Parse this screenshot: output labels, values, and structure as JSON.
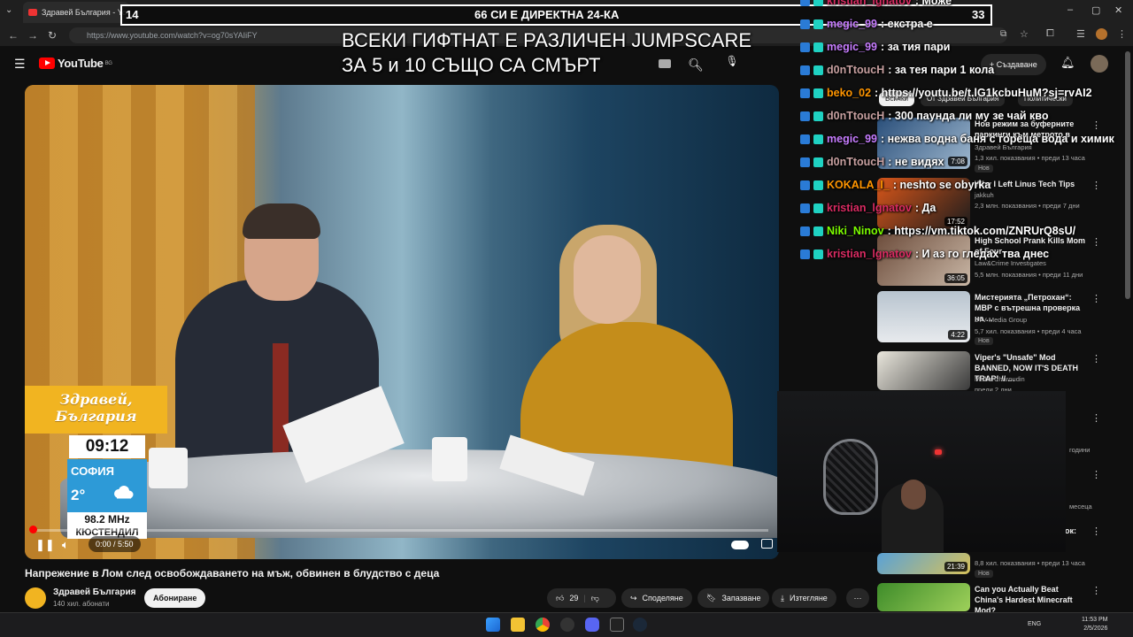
{
  "browser": {
    "tab_title": "Здравей България - YouTube",
    "url": "https://www.youtube.com/watch?v=og70sYAIiFY"
  },
  "youtube": {
    "logo_text": "YouTube",
    "logo_country": "BG",
    "create_label": "+ Създаване"
  },
  "overlay": {
    "left_count": "14",
    "center_text": "66 СИ Е ДИРЕКТНА 24-КА",
    "right_count": "33",
    "banner_line1": "ВСЕКИ ГИФТНАТ Е РАЗЛИЧЕН JUMPSCARE",
    "banner_line2": "ЗА 5 и 10 СЪЩО СА СМЪРТ"
  },
  "chat": [
    {
      "user": "kristian_lgnatov",
      "msg": ": Може",
      "color": "#d92b62"
    },
    {
      "user": "megic_99",
      "msg": ": екстра е",
      "color": "#c77dff"
    },
    {
      "user": "megic_99",
      "msg": ": за тия пари",
      "color": "#c77dff"
    },
    {
      "user": "d0nTtoucH",
      "msg": ": за тея пари 1 кола",
      "color": "#c7a0a0"
    },
    {
      "user": "beko_02",
      "msg": ": https://youtu.be/t.lG1kcbuHuM?sj=rvAI2",
      "color": "#ff9500"
    },
    {
      "user": "d0nTtoucH",
      "msg": ": 300 паунда ли му зе чай кво",
      "color": "#c7a0a0"
    },
    {
      "user": "megic_99",
      "msg": ": нежва водна баня с гореща вода и химик",
      "color": "#c77dff"
    },
    {
      "user": "d0nTtoucH",
      "msg": ": не видях",
      "color": "#c7a0a0"
    },
    {
      "user": "KOKALA_I_",
      "msg": ": neshto se obyrka",
      "color": "#ff9500"
    },
    {
      "user": "kristian_lgnatov",
      "msg": ": Да",
      "color": "#d92b62"
    },
    {
      "user": "Niki_Ninov",
      "msg": ": https://vm.tiktok.com/ZNRUrQ8sU/",
      "color": "#7cfc00"
    },
    {
      "user": "kristian_lgnatov",
      "msg": ": И аз го гледах тва днес",
      "color": "#d92b62"
    }
  ],
  "video": {
    "show_logo_line1": "Здравей,",
    "show_logo_line2": "България",
    "clock": "09:12",
    "weather_city": "СОФИЯ",
    "weather_temp": "2°",
    "radio_freq": "98.2 MHz",
    "radio_city": "КЮСТЕНДИЛ",
    "time_display": "0:00 / 5:50",
    "progress": 0
  },
  "meta": {
    "title": "Напрежение в Лом след освобождаването на мъж, обвинен в блудство с деца",
    "channel": "Здравей България",
    "subscribers": "140 хил. абонати",
    "subscribe_label": "Абониране",
    "likes": "29",
    "share_label": "Споделяне",
    "save_label": "Запазване",
    "download_label": "Изтегляне"
  },
  "sidebar": {
    "chips": [
      "Всички",
      "От Здравей България",
      "Политически"
    ],
    "videos": [
      {
        "title": "Нов режим за буферните паркинги към метрото в",
        "channel": "Здравей България",
        "meta": "1,3 хил. показвания • преди 13 часа",
        "duration": "7:08",
        "badge": "Нов"
      },
      {
        "title": "Why I Left Linus Tech Tips",
        "channel": "jakkuh",
        "meta": "2,3 млн. показвания • преди 7 дни",
        "duration": "17:52",
        "badge": ""
      },
      {
        "title": "High School Prank Kills Mom of Four",
        "channel": "Law&Crime Investigates",
        "meta": "5,5 млн. показвания • преди 11 дни",
        "duration": "36:05",
        "badge": ""
      },
      {
        "title": "Мистерията „Петрохан“: МВР с вътрешна проверка на ...",
        "channel": "bTV Media Group",
        "meta": "5,7 хил. показвания • преди 4 часа",
        "duration": "4:22",
        "badge": "Нов"
      },
      {
        "title": "Viper's \"Unsafe\" Mod BANNED, NOW IT'S DEATH TRAP! // ...",
        "channel": "Misha Charoudin",
        "meta": "преди 2 дни",
        "duration": "",
        "badge": ""
      },
      {
        "title": "",
        "channel": "",
        "meta": "8,8 хил. показвания • преди 13 часа",
        "duration": "21:39",
        "badge": ""
      },
      {
        "title": "Can you Actually Beat China's Hardest Minecraft Mod?",
        "channel": "",
        "meta": "",
        "duration": "",
        "badge": ""
      }
    ],
    "partial_meta_1": "години",
    "partial_meta_2": "месеца",
    "partial_title_frag": "ок:"
  },
  "taskbar": {
    "lang": "ENG",
    "time": "11:53 PM",
    "date": "2/5/2026"
  }
}
